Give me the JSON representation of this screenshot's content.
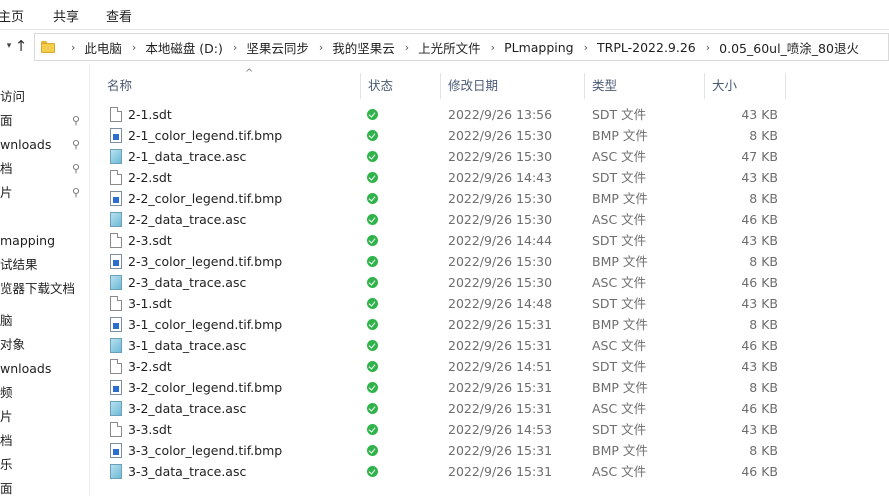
{
  "ribbon": {
    "tabs": [
      "主页",
      "共享",
      "查看"
    ]
  },
  "address": {
    "crumbs": [
      "此电脑",
      "本地磁盘 (D:)",
      "坚果云同步",
      "我的坚果云",
      "上光所文件",
      "PLmapping",
      "TRPL-2022.9.26",
      "0.05_60ul_喷涂_80退火"
    ],
    "up_icon": "arrow-up-icon",
    "dropdown_icon": "chevron-down-icon",
    "folder_icon": "folder-icon",
    "separator": "›"
  },
  "nav": {
    "items": [
      "访问",
      "面",
      "wnloads",
      "档",
      "片",
      "mapping",
      "试结果",
      "览器下载文档",
      "脑",
      "对象",
      "wnloads",
      "频",
      "片",
      "档",
      "乐",
      "面"
    ],
    "pin_glyph": "⚲"
  },
  "columns": {
    "name": "名称",
    "status": "状态",
    "modified": "修改日期",
    "type": "类型",
    "size": "大小",
    "sort_indicator": "^"
  },
  "files": [
    {
      "name": "2-1.sdt",
      "icon": "sdt",
      "date": "2022/9/26 13:56",
      "type": "SDT 文件",
      "size": "43 KB"
    },
    {
      "name": "2-1_color_legend.tif.bmp",
      "icon": "bmp",
      "date": "2022/9/26 15:30",
      "type": "BMP 文件",
      "size": "8 KB"
    },
    {
      "name": "2-1_data_trace.asc",
      "icon": "asc",
      "date": "2022/9/26 15:30",
      "type": "ASC 文件",
      "size": "47 KB"
    },
    {
      "name": "2-2.sdt",
      "icon": "sdt",
      "date": "2022/9/26 14:43",
      "type": "SDT 文件",
      "size": "43 KB"
    },
    {
      "name": "2-2_color_legend.tif.bmp",
      "icon": "bmp",
      "date": "2022/9/26 15:30",
      "type": "BMP 文件",
      "size": "8 KB"
    },
    {
      "name": "2-2_data_trace.asc",
      "icon": "asc",
      "date": "2022/9/26 15:30",
      "type": "ASC 文件",
      "size": "46 KB"
    },
    {
      "name": "2-3.sdt",
      "icon": "sdt",
      "date": "2022/9/26 14:44",
      "type": "SDT 文件",
      "size": "43 KB"
    },
    {
      "name": "2-3_color_legend.tif.bmp",
      "icon": "bmp",
      "date": "2022/9/26 15:30",
      "type": "BMP 文件",
      "size": "8 KB"
    },
    {
      "name": "2-3_data_trace.asc",
      "icon": "asc",
      "date": "2022/9/26 15:30",
      "type": "ASC 文件",
      "size": "46 KB"
    },
    {
      "name": "3-1.sdt",
      "icon": "sdt",
      "date": "2022/9/26 14:48",
      "type": "SDT 文件",
      "size": "43 KB"
    },
    {
      "name": "3-1_color_legend.tif.bmp",
      "icon": "bmp",
      "date": "2022/9/26 15:31",
      "type": "BMP 文件",
      "size": "8 KB"
    },
    {
      "name": "3-1_data_trace.asc",
      "icon": "asc",
      "date": "2022/9/26 15:31",
      "type": "ASC 文件",
      "size": "46 KB"
    },
    {
      "name": "3-2.sdt",
      "icon": "sdt",
      "date": "2022/9/26 14:51",
      "type": "SDT 文件",
      "size": "43 KB"
    },
    {
      "name": "3-2_color_legend.tif.bmp",
      "icon": "bmp",
      "date": "2022/9/26 15:31",
      "type": "BMP 文件",
      "size": "8 KB"
    },
    {
      "name": "3-2_data_trace.asc",
      "icon": "asc",
      "date": "2022/9/26 15:31",
      "type": "ASC 文件",
      "size": "46 KB"
    },
    {
      "name": "3-3.sdt",
      "icon": "sdt",
      "date": "2022/9/26 14:53",
      "type": "SDT 文件",
      "size": "43 KB"
    },
    {
      "name": "3-3_color_legend.tif.bmp",
      "icon": "bmp",
      "date": "2022/9/26 15:31",
      "type": "BMP 文件",
      "size": "8 KB"
    },
    {
      "name": "3-3_data_trace.asc",
      "icon": "asc",
      "date": "2022/9/26 15:31",
      "type": "ASC 文件",
      "size": "46 KB"
    }
  ],
  "colors": {
    "status_synced": "#2fb34a",
    "header_text": "#4a5a75",
    "folder": "#f5cd4c"
  }
}
